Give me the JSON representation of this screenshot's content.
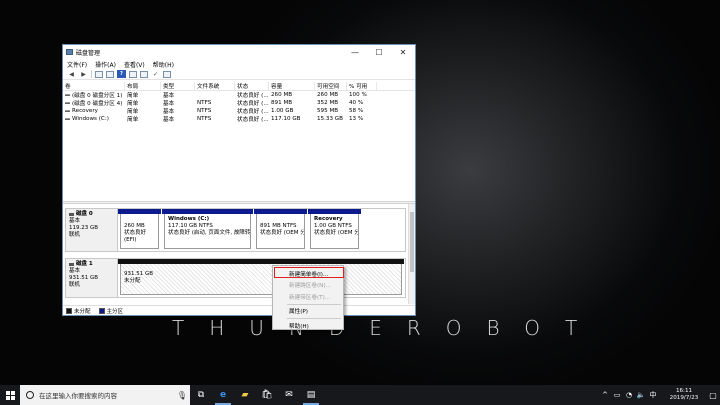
{
  "desktop": {
    "brand_text": "THUNDEROBOT"
  },
  "window": {
    "title": "磁盘管理",
    "controls": {
      "minimize": "—",
      "maximize": "☐",
      "close": "✕"
    },
    "menu": [
      "文件(F)",
      "操作(A)",
      "查看(V)",
      "帮助(H)"
    ]
  },
  "table": {
    "headers": [
      "卷",
      "布局",
      "类型",
      "文件系统",
      "状态",
      "容量",
      "可用空间",
      "% 可用"
    ],
    "rows": [
      [
        "(磁盘 0 磁盘分区 1)",
        "简单",
        "基本",
        "",
        "状态良好 (...",
        "260 MB",
        "260 MB",
        "100 %"
      ],
      [
        "(磁盘 0 磁盘分区 4)",
        "简单",
        "基本",
        "NTFS",
        "状态良好 (...",
        "891 MB",
        "352 MB",
        "40 %"
      ],
      [
        "Recovery",
        "简单",
        "基本",
        "NTFS",
        "状态良好 (...",
        "1.00 GB",
        "595 MB",
        "58 %"
      ],
      [
        "Windows (C:)",
        "简单",
        "基本",
        "NTFS",
        "状态良好 (...",
        "117.10 GB",
        "15.33 GB",
        "13 %"
      ]
    ]
  },
  "disk0": {
    "label": [
      "磁盘 0",
      "基本",
      "119.23 GB",
      "联机"
    ],
    "parts": [
      {
        "name": "",
        "l1": "260 MB",
        "l2": "状态良好 (EFI)"
      },
      {
        "name": "Windows (C:)",
        "l1": "117.10 GB NTFS",
        "l2": "状态良好 (启动, 页面文件, 故障转储"
      },
      {
        "name": "",
        "l1": "891 MB NTFS",
        "l2": "状态良好 (OEM 分"
      },
      {
        "name": "Recovery",
        "l1": "1.00 GB NTFS",
        "l2": "状态良好 (OEM 分区"
      }
    ]
  },
  "disk1": {
    "label": [
      "磁盘 1",
      "基本",
      "931.51 GB",
      "联机"
    ],
    "part": {
      "l1": "931.51 GB",
      "l2": "未分配"
    }
  },
  "legend": {
    "unallocated": "未分配",
    "primary": "主分区"
  },
  "context_menu": {
    "items": [
      "新建简单卷(I)...",
      "新建跨区卷(N)...",
      "新建带区卷(T)...",
      "属性(P)",
      "帮助(H)"
    ]
  },
  "taskbar": {
    "search_placeholder": "在这里输入你要搜索的内容",
    "ime": "中",
    "time": "16:11",
    "date": "2019/7/23"
  },
  "colors": {
    "partition_bar": "#0b1a8c",
    "unallocated_bar": "#111111",
    "highlight": "#e02020"
  },
  "icons": [
    "windows-logo-icon",
    "cortana-icon",
    "mic-icon",
    "task-view-icon",
    "edge-icon",
    "file-explorer-icon",
    "store-icon",
    "mail-icon",
    "disk-management-icon"
  ]
}
